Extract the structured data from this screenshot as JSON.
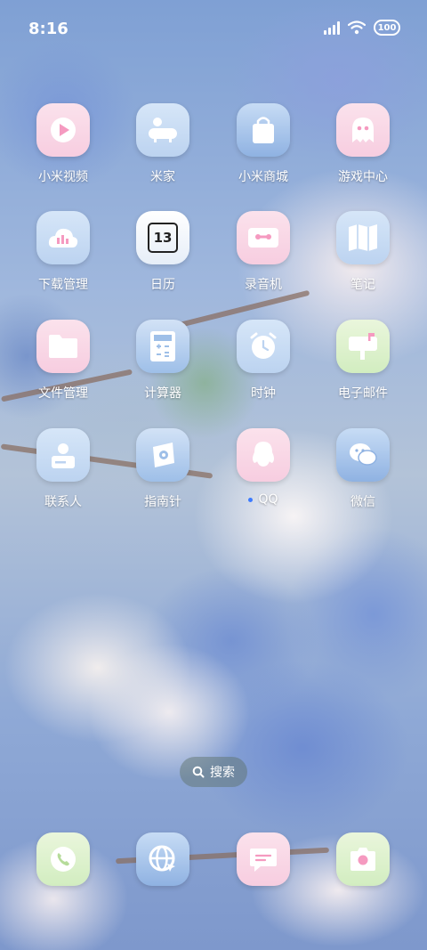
{
  "status_bar": {
    "time": "8:16",
    "battery": "100"
  },
  "apps": [
    {
      "label": "小米视频",
      "icon": "play-icon"
    },
    {
      "label": "米家",
      "icon": "bath-icon"
    },
    {
      "label": "小米商城",
      "icon": "shopping-bag-icon"
    },
    {
      "label": "游戏中心",
      "icon": "ghost-icon"
    },
    {
      "label": "下载管理",
      "icon": "download-cloud-icon"
    },
    {
      "label": "日历",
      "icon": "calendar-icon",
      "day": "13"
    },
    {
      "label": "录音机",
      "icon": "cassette-icon"
    },
    {
      "label": "笔记",
      "icon": "notebook-icon"
    },
    {
      "label": "文件管理",
      "icon": "folder-icon"
    },
    {
      "label": "计算器",
      "icon": "calculator-icon"
    },
    {
      "label": "时钟",
      "icon": "alarm-clock-icon"
    },
    {
      "label": "电子邮件",
      "icon": "mailbox-icon"
    },
    {
      "label": "联系人",
      "icon": "contact-card-icon"
    },
    {
      "label": "指南针",
      "icon": "compass-icon"
    },
    {
      "label": "QQ",
      "icon": "qq-penguin-icon"
    },
    {
      "label": "微信",
      "icon": "wechat-icon"
    }
  ],
  "search": {
    "label": "搜索"
  },
  "dock": [
    {
      "name": "phone",
      "icon": "phone-icon"
    },
    {
      "name": "browser",
      "icon": "globe-icon"
    },
    {
      "name": "messages",
      "icon": "message-icon"
    },
    {
      "name": "camera",
      "icon": "camera-icon"
    }
  ],
  "colors": {
    "pink_tile": "#f7cde0",
    "blue_tile": "#bcd3f0",
    "green_tile": "#d2edc0",
    "notification_dot": "#3c7bff"
  }
}
